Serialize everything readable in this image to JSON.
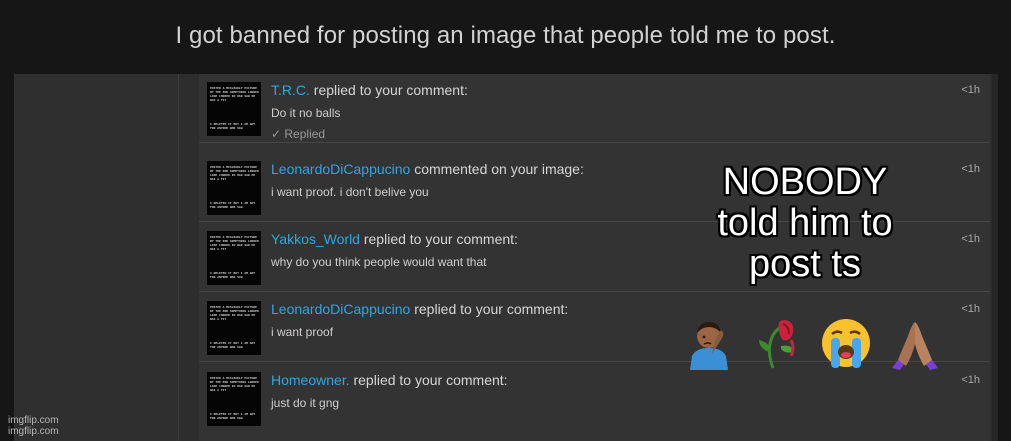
{
  "title": "I got banned for posting an image that people told me to post.",
  "notifications": [
    {
      "user": "T.R.C.",
      "action": "replied to your comment:",
      "comment": "Do it no balls",
      "status": "✓ Replied",
      "time": "<1h"
    },
    {
      "user": "LeonardoDiCappucino",
      "action": "commented on your image:",
      "comment": "i want proof. i don't belive you",
      "status": "",
      "time": "<1h"
    },
    {
      "user": "Yakkos_World",
      "action": "replied to your comment:",
      "comment": "why do you think people would want that",
      "status": "",
      "time": "<1h"
    },
    {
      "user": "LeonardoDiCappucino",
      "action": "replied to your comment:",
      "comment": "i want proof",
      "status": "",
      "time": "<1h"
    },
    {
      "user": "Homeowner.",
      "action": "replied to your comment:",
      "comment": "just do it gng",
      "status": "",
      "time": "<1h"
    }
  ],
  "thumbnail": {
    "top_text": "POSTED A MISLEADLY PICTURE BY THE END SOMETHING LOOKED LIKE CHOKED IN HAD SAW HE WAS A FIT",
    "bottom_text": "I DELETED IT BUT I AM ANY FOR ANYONE WHO SAW"
  },
  "overlay": {
    "line1": "NOBODY",
    "line2": "told him to",
    "line3": "post ts"
  },
  "emojis": [
    "face-palm-person-icon",
    "wilted-rose-icon",
    "loudly-crying-face-icon",
    "folded-hands-icon"
  ],
  "watermark": {
    "line1": "imgflip.com",
    "line2": "imgflip.com"
  },
  "colors": {
    "username": "#2ea7e0",
    "background": "#161616",
    "panel": "#333333"
  }
}
